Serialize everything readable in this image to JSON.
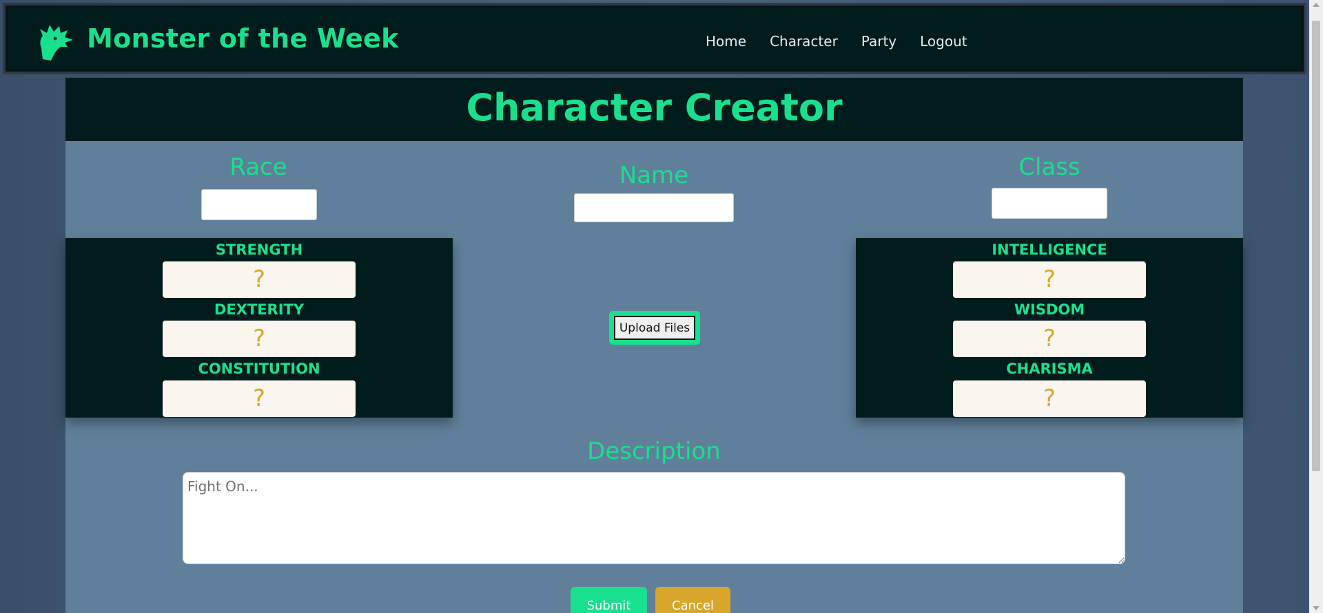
{
  "brand": {
    "title": "Monster of the Week",
    "logo_icon": "dragon-head-icon"
  },
  "nav": {
    "links": [
      "Home",
      "Character",
      "Party",
      "Logout"
    ]
  },
  "page": {
    "title": "Character Creator"
  },
  "fields": {
    "race": {
      "label": "Race",
      "value": ""
    },
    "name": {
      "label": "Name",
      "value": ""
    },
    "class": {
      "label": "Class",
      "value": ""
    }
  },
  "stats_left": [
    {
      "label": "STRENGTH",
      "value": "?"
    },
    {
      "label": "DEXTERITY",
      "value": "?"
    },
    {
      "label": "CONSTITUTION",
      "value": "?"
    }
  ],
  "stats_right": [
    {
      "label": "INTELLIGENCE",
      "value": "?"
    },
    {
      "label": "WISDOM",
      "value": "?"
    },
    {
      "label": "CHARISMA",
      "value": "?"
    }
  ],
  "upload": {
    "label": "Upload Files"
  },
  "description": {
    "label": "Description",
    "placeholder": "Fight On..."
  },
  "actions": {
    "submit": "Submit",
    "cancel": "Cancel"
  },
  "colors": {
    "accent": "#19e08e",
    "dark": "#001c1c",
    "panel": "#607f9a",
    "gold": "#d7a62a",
    "stat_box_fill": "#fbf5f0"
  }
}
